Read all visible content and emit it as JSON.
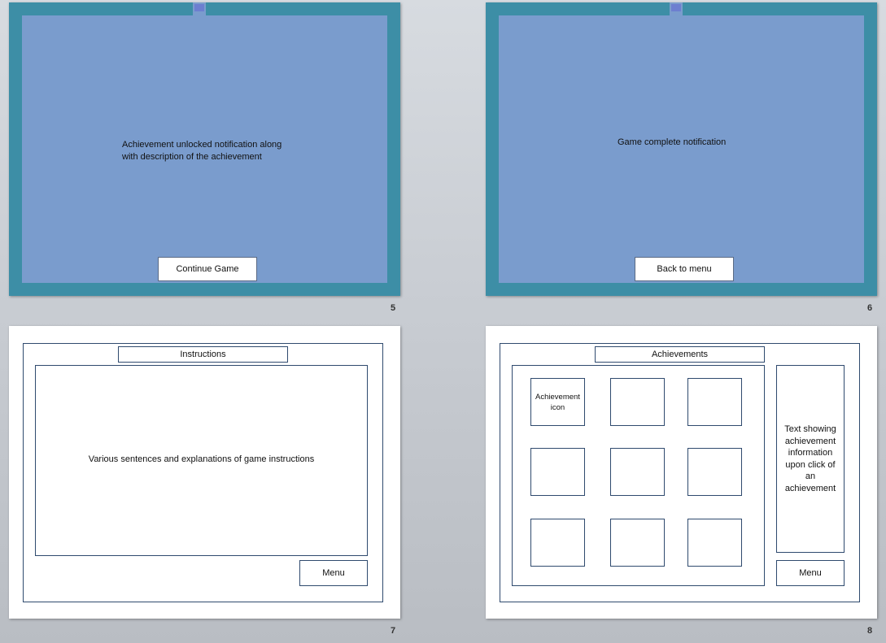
{
  "slides": [
    {
      "number": "5",
      "notification": "Achievement unlocked notification along with description of the achievement",
      "button_label": "Continue Game"
    },
    {
      "number": "6",
      "notification": "Game complete notification",
      "button_label": "Back to menu"
    },
    {
      "number": "7",
      "title": "Instructions",
      "body": "Various sentences and explanations of game instructions",
      "menu_label": "Menu"
    },
    {
      "number": "8",
      "title": "Achievements",
      "first_icon_label": "Achievement icon",
      "info_text": "Text showing achievement information upon click of an achievement",
      "menu_label": "Menu"
    }
  ],
  "colors": {
    "slide_border": "#3d8ea6",
    "slide_fill": "#7a9ccd",
    "wireframe_line": "#2f4a6e"
  }
}
